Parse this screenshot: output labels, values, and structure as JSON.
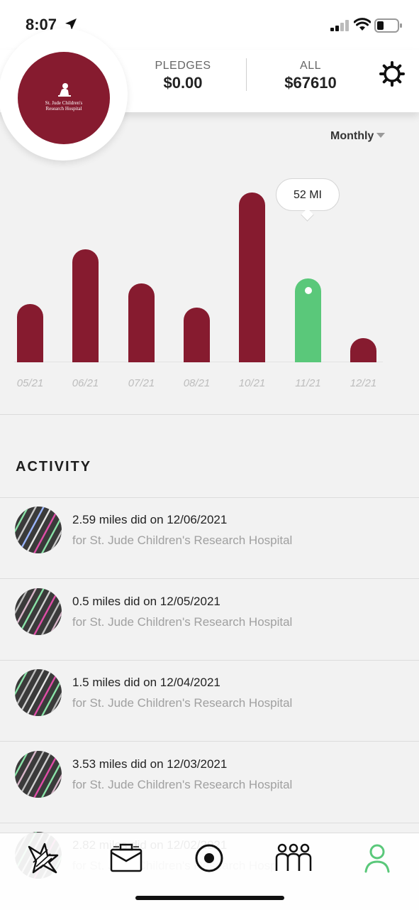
{
  "status_bar": {
    "time": "8:07"
  },
  "header": {
    "logo_text_line1": "St. Jude Children's",
    "logo_text_line2": "Research Hospital",
    "pledges_label": "PLEDGES",
    "pledges_value": "$0.00",
    "all_label": "ALL",
    "all_value": "$67610"
  },
  "period_selector": {
    "value": "Monthly"
  },
  "chart_data": {
    "type": "bar",
    "categories": [
      "05/21",
      "06/21",
      "07/21",
      "08/21",
      "10/21",
      "11/21",
      "12/21"
    ],
    "values": [
      36,
      70,
      49,
      34,
      105,
      52,
      15
    ],
    "selected_index": 5,
    "tooltip": "52 MI",
    "colors": {
      "bar": "#861b2f",
      "selected": "#5ac87a"
    },
    "title": "",
    "xlabel": "",
    "ylabel": ""
  },
  "activity": {
    "title": "ACTIVITY",
    "items": [
      {
        "line1": "2.59 miles did on 12/06/2021",
        "line2": "for St. Jude Children's Research Hospital"
      },
      {
        "line1": "0.5 miles did on 12/05/2021",
        "line2": "for St. Jude Children's Research Hospital"
      },
      {
        "line1": "1.5 miles did on 12/04/2021",
        "line2": "for St. Jude Children's Research Hospital"
      },
      {
        "line1": "3.53 miles did on 12/03/2021",
        "line2": "for St. Jude Children's Research Hospital"
      },
      {
        "line1": "2.82 miles did on 12/02/2021",
        "line2": "for St. Jude Children's Research Hospital"
      }
    ]
  },
  "tab_bar": {
    "tabs": [
      {
        "icon": "burst-icon"
      },
      {
        "icon": "briefcase-icon"
      },
      {
        "icon": "record-icon"
      },
      {
        "icon": "team-icon"
      },
      {
        "icon": "profile-icon",
        "active": true
      }
    ],
    "active_color": "#5ac87a"
  }
}
